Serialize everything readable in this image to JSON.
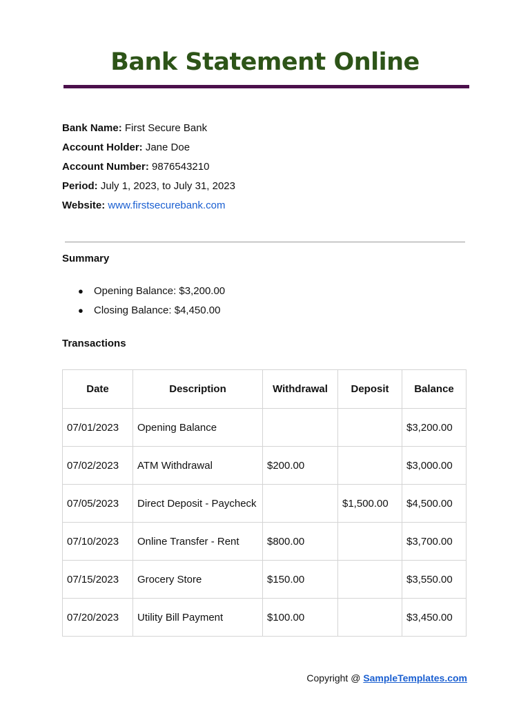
{
  "title": "Bank Statement Online",
  "colors": {
    "title": "#2d5418",
    "rule": "#4b0f4b",
    "link": "#1a5fd1"
  },
  "info": {
    "bank_name_label": "Bank Name:",
    "bank_name": "First Secure Bank",
    "account_holder_label": "Account Holder:",
    "account_holder": "Jane Doe",
    "account_number_label": "Account Number:",
    "account_number": "9876543210",
    "period_label": "Period:",
    "period": "July 1, 2023, to July 31, 2023",
    "website_label": "Website:",
    "website": "www.firstsecurebank.com"
  },
  "summary": {
    "heading": "Summary",
    "items": [
      "Opening Balance: $3,200.00",
      "Closing Balance: $4,450.00"
    ]
  },
  "transactions": {
    "heading": "Transactions",
    "columns": [
      "Date",
      "Description",
      "Withdrawal",
      "Deposit",
      "Balance"
    ],
    "rows": [
      [
        "07/01/2023",
        "Opening Balance",
        "",
        "",
        "$3,200.00"
      ],
      [
        "07/02/2023",
        "ATM Withdrawal",
        "$200.00",
        "",
        "$3,000.00"
      ],
      [
        "07/05/2023",
        "Direct Deposit - Paycheck",
        "",
        "$1,500.00",
        "$4,500.00"
      ],
      [
        "07/10/2023",
        "Online Transfer - Rent",
        "$800.00",
        "",
        "$3,700.00"
      ],
      [
        "07/15/2023",
        "Grocery Store",
        "$150.00",
        "",
        "$3,550.00"
      ],
      [
        "07/20/2023",
        "Utility Bill Payment",
        "$100.00",
        "",
        "$3,450.00"
      ]
    ]
  },
  "footer": {
    "copyright_prefix": "Copyright @ ",
    "copyright_link": "SampleTemplates.com"
  }
}
